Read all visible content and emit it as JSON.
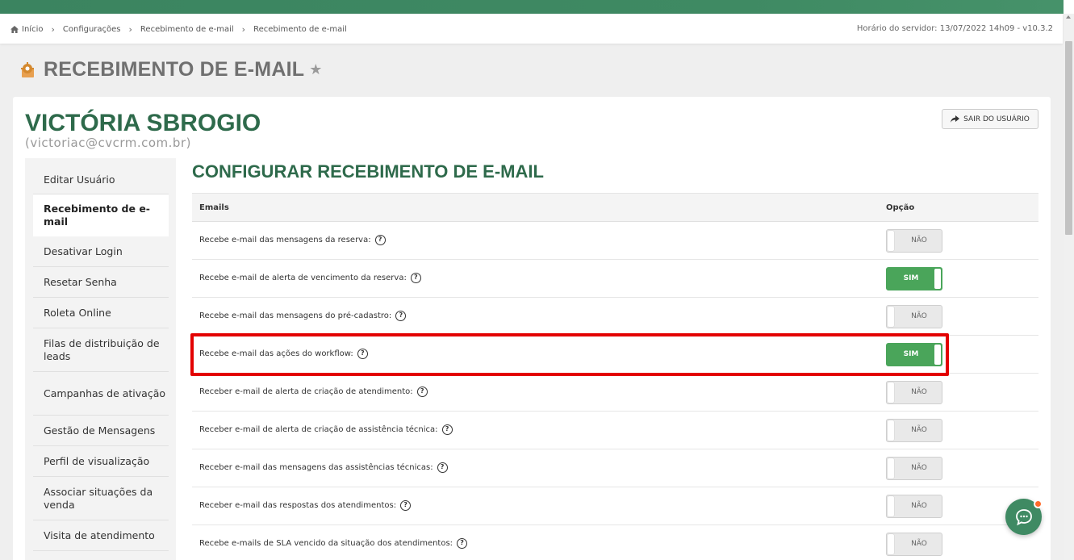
{
  "breadcrumb": {
    "items": [
      "Início",
      "Configurações",
      "Recebimento de e-mail",
      "Recebimento de e-mail"
    ]
  },
  "server_time": "Horário do servidor: 13/07/2022 14h09 - v10.3.2",
  "page": {
    "title": "RECEBIMENTO DE E-MAIL"
  },
  "user": {
    "name": "VICTÓRIA SBROGIO",
    "email": "(victoriac@cvcrm.com.br)",
    "logout_label": "SAIR DO USUÁRIO"
  },
  "side_menu": {
    "items": [
      {
        "label": "Editar Usuário"
      },
      {
        "label": "Recebimento de e-mail"
      },
      {
        "label": "Desativar Login"
      },
      {
        "label": "Resetar Senha"
      },
      {
        "label": "Roleta Online"
      },
      {
        "label": "Filas de distribuição de leads"
      },
      {
        "label": "Campanhas de ativação"
      },
      {
        "label": "Gestão de Mensagens"
      },
      {
        "label": "Perfil de visualização"
      },
      {
        "label": "Associar situações da venda"
      },
      {
        "label": "Visita de atendimento"
      }
    ],
    "active_index": 1
  },
  "section": {
    "title": "CONFIGURAR RECEBIMENTO DE E-MAIL",
    "col_emails": "Emails",
    "col_option": "Opção"
  },
  "rows": [
    {
      "label": "Recebe e-mail das mensagens da reserva:",
      "toggle": "NÃO",
      "on": false
    },
    {
      "label": "Recebe e-mail de alerta de vencimento da reserva:",
      "toggle": "SIM",
      "on": true
    },
    {
      "label": "Recebe e-mail das mensagens do pré-cadastro:",
      "toggle": "NÃO",
      "on": false
    },
    {
      "label": "Recebe e-mail das ações do workflow:",
      "toggle": "SIM",
      "on": true
    },
    {
      "label": "Receber e-mail de alerta de criação de atendimento:",
      "toggle": "NÃO",
      "on": false
    },
    {
      "label": "Receber e-mail de alerta de criação de assistência técnica:",
      "toggle": "NÃO",
      "on": false
    },
    {
      "label": "Receber e-mail das mensagens das assistências técnicas:",
      "toggle": "NÃO",
      "on": false
    },
    {
      "label": "Receber e-mail das respostas dos atendimentos:",
      "toggle": "NÃO",
      "on": false
    },
    {
      "label": "Recebe e-mails de SLA vencido da situação dos atendimentos:",
      "toggle": "NÃO",
      "on": false
    }
  ],
  "help_glyph": "?",
  "colors": {
    "brand_green": "#3f8a63",
    "title_green": "#2e6a4b",
    "toggle_on": "#4aa55a",
    "highlight_red": "#e30000",
    "notification": "#ff6a2a"
  },
  "icons": {
    "home": "home-icon",
    "star": "star-icon",
    "logout": "share-arrow-icon",
    "help": "question-circle-icon",
    "chat": "chat-bubble-icon",
    "page_logo": "gear-box-icon"
  }
}
